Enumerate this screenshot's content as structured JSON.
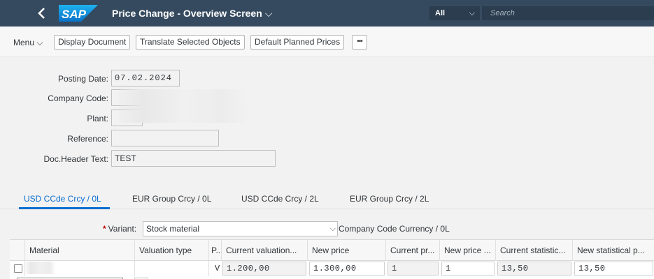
{
  "shell": {
    "title": "Price Change - Overview Screen",
    "scope": "All",
    "search_placeholder": "Search",
    "logo_text": "SAP"
  },
  "toolbar": {
    "menu_label": "Menu",
    "buttons": [
      "Display Document",
      "Translate Selected Objects",
      "Default Planned Prices"
    ],
    "more_label": "•••"
  },
  "form": {
    "posting_date_label": "Posting Date:",
    "posting_date_value": "07.02.2024",
    "company_code_label": "Company Code:",
    "plant_label": "Plant:",
    "reference_label": "Reference:",
    "reference_value": "",
    "doc_header_label": "Doc.Header Text:",
    "doc_header_value": "TEST"
  },
  "tabs": [
    "USD  CCde Crcy / 0L",
    "EUR  Group Crcy / 0L",
    "USD  CCde Crcy / 2L",
    "EUR  Group Crcy / 2L"
  ],
  "variant": {
    "label": "Variant:",
    "value": "Stock material",
    "currency_text": "Company Code Currency / 0L"
  },
  "table": {
    "columns": [
      "Material",
      "Valuation type",
      "P...",
      "Current valuation...",
      "New price",
      "Current pr...",
      "New price ...",
      "Current statistic...",
      "New statistical p..."
    ],
    "rows": [
      {
        "material": "",
        "valuation_type": "",
        "p": "V",
        "current_valuation": "1.200,00",
        "new_price": "1.300,00",
        "current_pr": "1",
        "new_price_unit": "1",
        "current_statistical": "13,50",
        "new_statistical": "13,50"
      }
    ]
  },
  "colors": {
    "shell_bg": "#354a5f",
    "accent": "#0a6ed1",
    "required": "#bb0000"
  }
}
